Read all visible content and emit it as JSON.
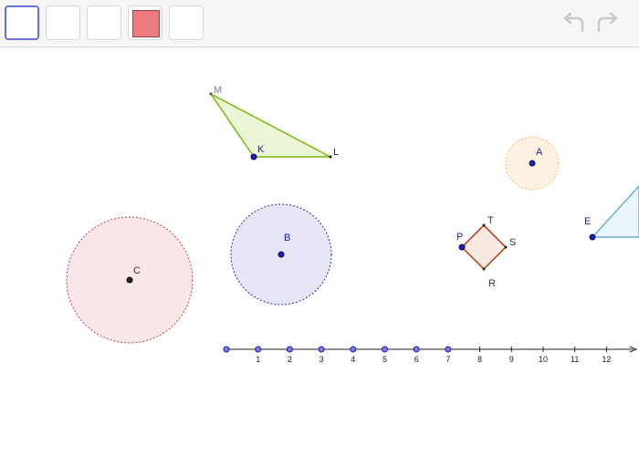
{
  "toolbar": {
    "tools": [
      {
        "name": "tool-1",
        "active": true
      },
      {
        "name": "tool-2",
        "active": false
      },
      {
        "name": "tool-3",
        "active": false
      },
      {
        "name": "tool-4",
        "swatch_color": "#ee7a7f"
      },
      {
        "name": "tool-5",
        "active": false
      }
    ],
    "undo_icon": "undo-arrow-icon",
    "redo_icon": "redo-arrow-icon",
    "icon_color": "#c9c9c9"
  },
  "graphics": {
    "points": {
      "M": "M",
      "K": "K",
      "L": "L",
      "A": "A",
      "B": "B",
      "C": "C",
      "P": "P",
      "T": "T",
      "S": "S",
      "R": "R",
      "E": "E"
    },
    "colors": {
      "triangle_stroke": "#77bb11",
      "triangle_fill": "#eaf6d5",
      "circle_A_fill": "#fdf2e2",
      "circle_A_stroke": "#f4b860",
      "circle_B_fill": "#e6e6f7",
      "circle_B_stroke": "#2a2aa8",
      "circle_C_fill": "#fbe6ea",
      "circle_C_stroke": "#c04050",
      "square_stroke": "#b43a0c",
      "square_fill": "#f7e8e2",
      "edge_shape_stroke": "#4c9fd6",
      "edge_shape_fill": "#eaf5fc",
      "point_blue": "#1f1fb0",
      "point_black": "#222222"
    },
    "number_line": {
      "ticks": [
        "1",
        "2",
        "3",
        "4",
        "5",
        "6",
        "7",
        "8",
        "9",
        "10",
        "11",
        "12"
      ]
    }
  }
}
